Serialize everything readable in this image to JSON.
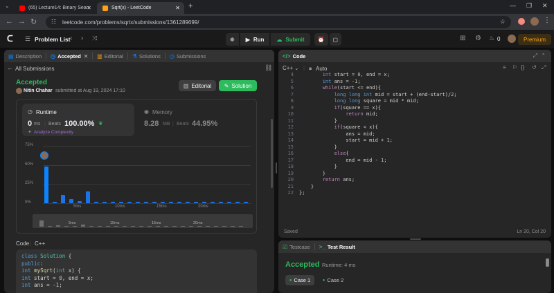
{
  "browser": {
    "tabs": [
      {
        "title": "(65) Lecture14: Binary Search In",
        "active": false
      },
      {
        "title": "Sqrt(x) - LeetCode",
        "active": true
      }
    ],
    "url": "leetcode.com/problems/sqrtx/submissions/1361289699/"
  },
  "nav": {
    "problem_list": "Problem List",
    "run": "Run",
    "submit": "Submit",
    "streak": "0",
    "premium": "Premium"
  },
  "left": {
    "tabs": [
      "Description",
      "Accepted",
      "Editorial",
      "Solutions",
      "Submissions"
    ],
    "all_submissions": "All Submissions",
    "status": "Accepted",
    "author": "Nitin Chahar",
    "submitted_text": "submitted at Aug 19, 2024 17:10",
    "editorial_btn": "Editorial",
    "solution_btn": "Solution",
    "runtime": {
      "label": "Runtime",
      "value": "0",
      "unit": "ms",
      "beats_label": "Beats",
      "beats": "100.00%",
      "analyze": "Analyze Complexity"
    },
    "memory": {
      "label": "Memory",
      "value": "8.28",
      "unit": "MB",
      "beats_label": "Beats",
      "beats": "44.95%"
    },
    "code_label": "Code",
    "lang": "C++",
    "code_preview": [
      "class Solution {",
      "public:",
      "    int mySqrt(int x) {",
      "        int start = 0, end = x;",
      "        int ans = -1;"
    ]
  },
  "chart_data": {
    "type": "bar",
    "ylim": [
      0,
      75
    ],
    "yticks": [
      "75%",
      "50%",
      "25%",
      "0%"
    ],
    "xticks": [
      "5ms",
      "10ms",
      "15ms",
      "20ms"
    ],
    "values": [
      48,
      2,
      11,
      5,
      3,
      15,
      2,
      2,
      2,
      2,
      2,
      2,
      2,
      2,
      2,
      2,
      2,
      2,
      2,
      2,
      2,
      2,
      2,
      2,
      2
    ],
    "mini_xticks": [
      "5ms",
      "10ms",
      "15ms",
      "20ms"
    ]
  },
  "right": {
    "code_title": "Code",
    "lang": "C++",
    "auto": "Auto",
    "saved": "Saved",
    "cursor": "Ln 20, Col 20",
    "lines": [
      {
        "n": "4",
        "text": "        int start = 0, end = x;"
      },
      {
        "n": "5",
        "text": "        int ans = -1;"
      },
      {
        "n": "6",
        "text": "        while(start <= end){"
      },
      {
        "n": "7",
        "text": "            long long int mid = start + (end-start)/2;"
      },
      {
        "n": "8",
        "text": "            long long square = mid * mid;"
      },
      {
        "n": "9",
        "text": "            if(square == x){"
      },
      {
        "n": "10",
        "text": "                return mid;"
      },
      {
        "n": "11",
        "text": "            }"
      },
      {
        "n": "12",
        "text": "            if(square < x){"
      },
      {
        "n": "13",
        "text": "                ans = mid;"
      },
      {
        "n": "14",
        "text": "                start = mid + 1;"
      },
      {
        "n": "15",
        "text": "            }"
      },
      {
        "n": "16",
        "text": "            else{"
      },
      {
        "n": "17",
        "text": "                end = mid - 1;"
      },
      {
        "n": "18",
        "text": "            }"
      },
      {
        "n": "19",
        "text": "        }"
      },
      {
        "n": "20",
        "text": "        return ans;"
      },
      {
        "n": "21",
        "text": "    }"
      },
      {
        "n": "22",
        "text": "};"
      }
    ],
    "testcase_tab": "Testcase",
    "result_tab": "Test Result",
    "result_status": "Accepted",
    "result_runtime": "Runtime: 4 ms",
    "cases": [
      "Case 1",
      "Case 2"
    ]
  },
  "colors": {
    "accent_green": "#2cbb5d",
    "accent_blue": "#0a84ff",
    "premium": "#ffa116"
  }
}
